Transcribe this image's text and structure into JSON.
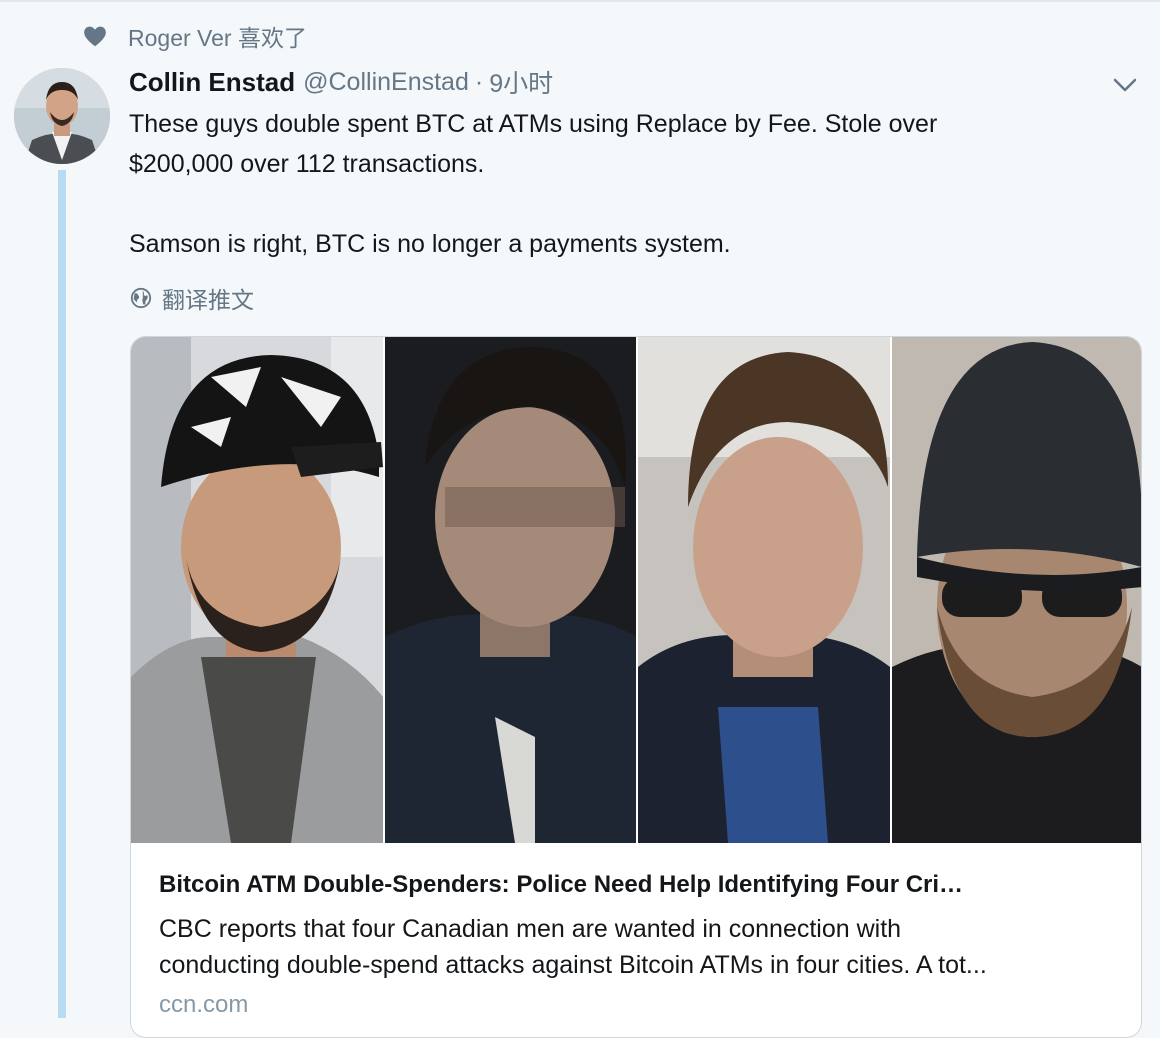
{
  "context": {
    "icon": "heart-icon",
    "text": "Roger Ver 喜欢了"
  },
  "tweet": {
    "author_name": "Collin Enstad",
    "author_handle": "@CollinEnstad",
    "separator": "·",
    "timestamp": "9小时",
    "text": {
      "line1": "These guys double spent BTC at ATMs using Replace by Fee. Stole over",
      "line2": "$200,000 over 112 transactions.",
      "line3": "Samson is right, BTC is no longer a payments system."
    },
    "translate_label": "翻译推文"
  },
  "card": {
    "title": "Bitcoin ATM Double-Spenders: Police Need Help Identifying Four Cri…",
    "description_line1": "CBC reports that four Canadian men are wanted in connection with",
    "description_line2": "conducting double-spend attacks against Bitcoin ATMs in four cities. A tot...",
    "domain": "ccn.com"
  },
  "colors": {
    "background": "#f5f8fa",
    "secondary_text": "#657786",
    "thread_line": "#b9dbf2",
    "card_border": "#ccd6dd"
  }
}
